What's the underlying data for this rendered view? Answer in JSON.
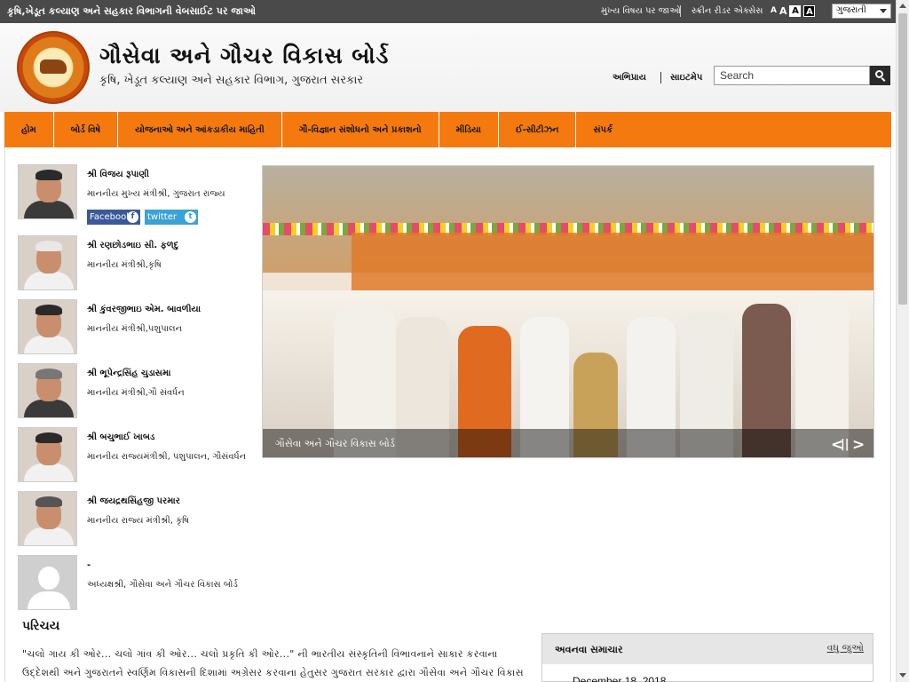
{
  "topbar": {
    "ministry_link": "કૃષિ,ખેડૂત કલ્યાણ અને સહકાર વિભાગની વેબસાઈટ પર જાઓ",
    "skip_main": "મુખ્ય વિષય પર જાઓ",
    "screen_reader": "સ્ક્રીન રીડર એક્સેસ",
    "font_small": "A",
    "font_normal": "A",
    "font_large": "A",
    "font_contrast": "A",
    "language": "ગુજરાતી"
  },
  "header": {
    "title": "ગૌસેવા અને ગૌચર વિકાસ બોર્ડ",
    "subtitle": "કૃષિ, ખેડૂત કલ્યાણ અને સહકાર વિભાગ, ગુજરાત સરકાર",
    "feedback": "અભિપ્રાય",
    "sitemap": "સાઇટમેપ",
    "search_placeholder": "Search"
  },
  "nav": [
    "હોમ",
    "બોર્ડ વિષે",
    "યોજનાઓ અને આંકડાકીય માહિતી",
    "ગૌ-વિજ્ઞાન સંશોધનો અને પ્રકાશનો",
    "મીડિયા",
    "ઈ-સીટીઝન",
    "સંપર્ક"
  ],
  "ministers": [
    {
      "name": "શ્રી વિજય રૂપાણી",
      "role": "માનનીય મુખ્ય મંત્રીશ્રી, ગુજરાત રાજ્ય"
    },
    {
      "name": "શ્રી રણછોડભાઇ સી. ફળદુ",
      "role": "માનનીય મંત્રીશ્રી,કૃષિ"
    },
    {
      "name": "શ્રી કુંવરજીભાઇ એમ. બાવળીયા",
      "role": "માનનીય મંત્રીશ્રી,પશુપાલન"
    },
    {
      "name": "શ્રી ભૂપેન્દ્રસિંહ ચુડાસમા",
      "role": "માનનીય મંત્રીશ્રી,ગૌ સંવર્ધન"
    },
    {
      "name": "શ્રી બચુભાઈ ખાબડ",
      "role": "માનનીય રાજ્યમંત્રીશ્રી, પશુપાલન, ગૌસંવર્ધન"
    },
    {
      "name": "શ્રી જયદ્રથસિંહજી પરમાર",
      "role": "માનનીય રાજ્ય મંત્રીશ્રી, કૃષિ"
    },
    {
      "name": "-",
      "role": "અધ્યક્ષશ્રી, ગૌસેવા અને ગૌચર વિકાસ બોર્ડ"
    }
  ],
  "social": {
    "facebook": "Facebook",
    "facebook_icon": "f",
    "twitter": "twitter",
    "twitter_icon": "t"
  },
  "slider": {
    "caption": "ગૌસેવા અને ગૌચર વિકાસ બોર્ડ",
    "prev": "<",
    "pause": "||",
    "next": ">"
  },
  "intro": {
    "title": "પરિચય",
    "text": "\"ચલો ગાય કી ઓર... ચલો ગાંવ કી ઓર... ચલો પ્રકૃતિ કી ઓર...\" ની ભારતીય સંસ્કૃતિની વિભાવનાને સાકાર કરવાના ઉદ્દેશથી અને ગુજરાતને સ્વર્ણિમ વિકાસની દિશામાં અગ્રેસર કરવાના હેતુસર ગુજરાત સરકાર દ્વારા ગૌસેવા અને ગૌચર વિકાસ"
  },
  "news": {
    "title": "અવનવા સમાચાર",
    "more": "વધુ જુઓ",
    "date": "December 18, 2018"
  }
}
